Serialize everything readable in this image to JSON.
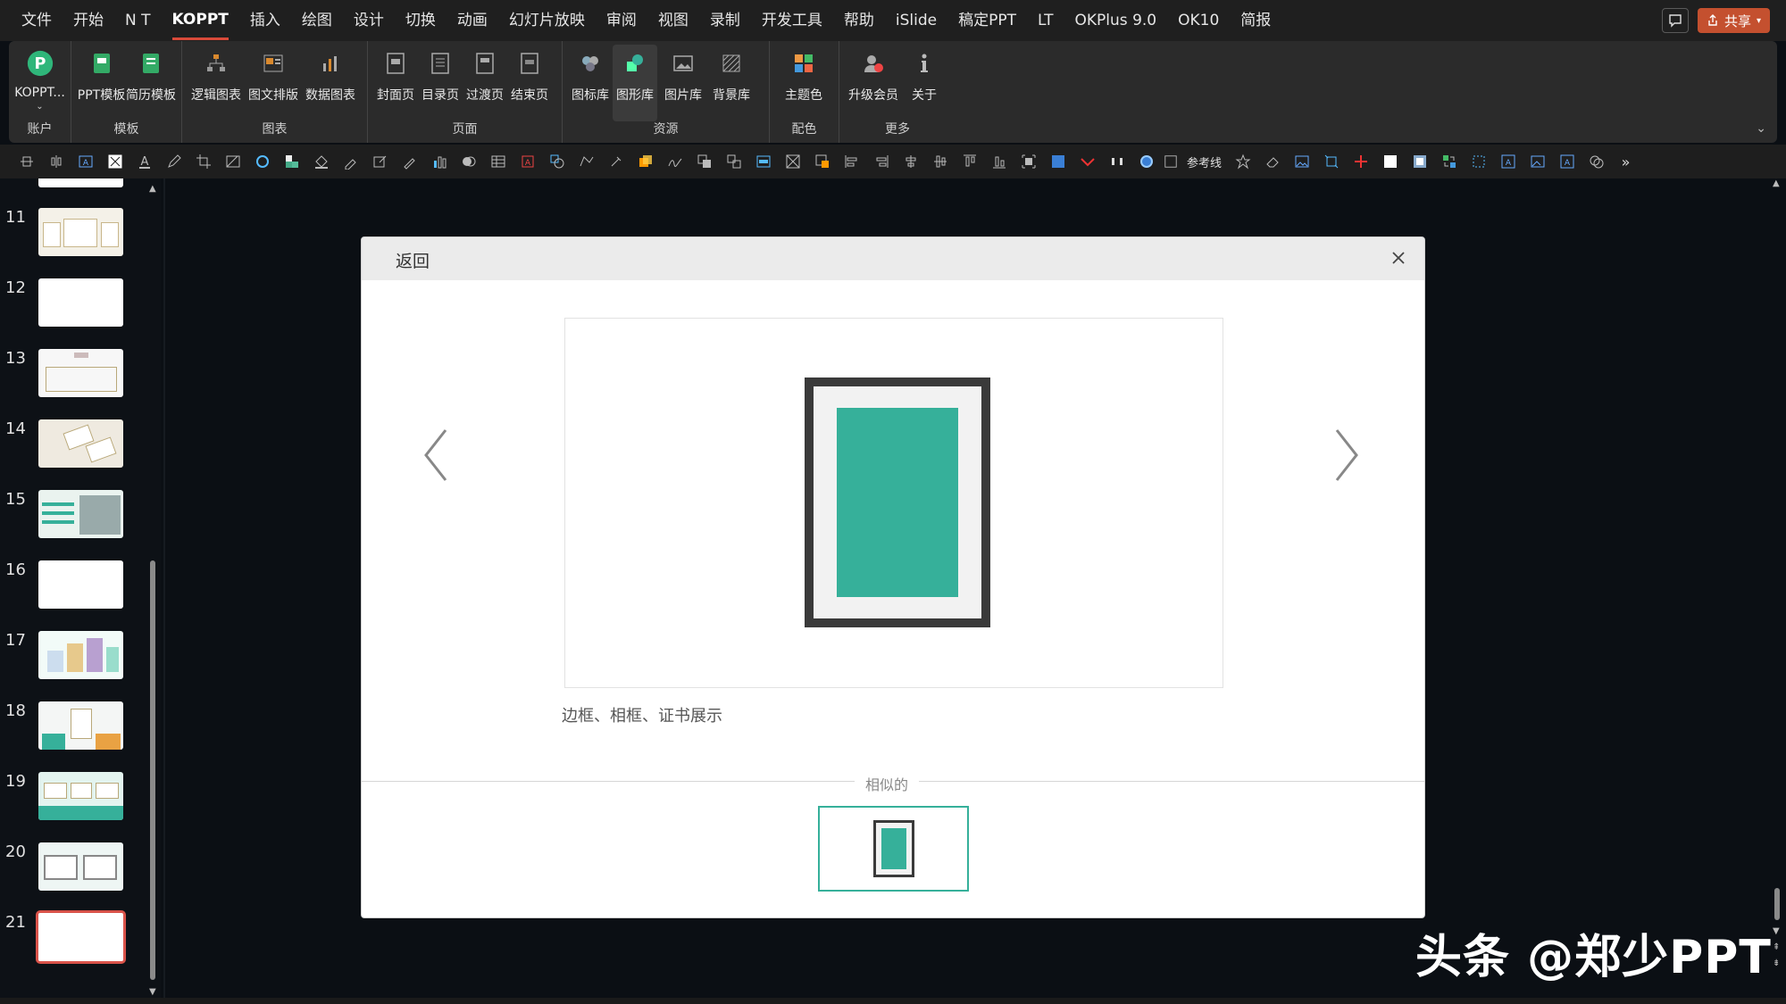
{
  "menubar": {
    "items": [
      "文件",
      "开始",
      "N T",
      "KOPPT",
      "插入",
      "绘图",
      "设计",
      "切换",
      "动画",
      "幻灯片放映",
      "审阅",
      "视图",
      "录制",
      "开发工具",
      "帮助",
      "iSlide",
      "稿定PPT",
      "LT",
      "OKPlus 9.0",
      "OK10",
      "简报"
    ],
    "active": "KOPPT",
    "share_label": "共享"
  },
  "ribbon": {
    "groups": [
      {
        "label": "账户",
        "buttons": [
          {
            "label": "KOPPT...",
            "icon": "koppt-logo-icon"
          }
        ]
      },
      {
        "label": "模板",
        "buttons": [
          {
            "label": "PPT模板",
            "icon": "ppt-template-icon"
          },
          {
            "label": "简历模板",
            "icon": "resume-template-icon"
          }
        ]
      },
      {
        "label": "图表",
        "buttons": [
          {
            "label": "逻辑图表",
            "icon": "logic-chart-icon"
          },
          {
            "label": "图文排版",
            "icon": "layout-icon"
          },
          {
            "label": "数据图表",
            "icon": "data-chart-icon"
          }
        ]
      },
      {
        "label": "页面",
        "buttons": [
          {
            "label": "封面页",
            "icon": "cover-page-icon"
          },
          {
            "label": "目录页",
            "icon": "toc-page-icon"
          },
          {
            "label": "过渡页",
            "icon": "transition-page-icon"
          },
          {
            "label": "结束页",
            "icon": "end-page-icon"
          }
        ]
      },
      {
        "label": "资源",
        "buttons": [
          {
            "label": "图标库",
            "icon": "icon-library-icon"
          },
          {
            "label": "图形库",
            "icon": "shape-library-icon"
          },
          {
            "label": "图片库",
            "icon": "image-library-icon"
          },
          {
            "label": "背景库",
            "icon": "background-library-icon"
          }
        ]
      },
      {
        "label": "配色",
        "buttons": [
          {
            "label": "主题色",
            "icon": "theme-color-icon"
          }
        ]
      },
      {
        "label": "更多",
        "buttons": [
          {
            "label": "升级会员",
            "icon": "upgrade-member-icon"
          },
          {
            "label": "关于",
            "icon": "about-icon"
          }
        ]
      }
    ]
  },
  "toolbar": {
    "reference_line_label": "参考线"
  },
  "slides": {
    "numbers": [
      "11",
      "12",
      "13",
      "14",
      "15",
      "16",
      "17",
      "18",
      "19",
      "20",
      "21"
    ],
    "selected": "21"
  },
  "dialog": {
    "back_label": "返回",
    "caption": "边框、相框、证书展示",
    "similar_label": "相似的"
  },
  "watermark": "头条 @郑少PPT",
  "colors": {
    "accent_teal": "#36b09a",
    "share_orange": "#c4502f",
    "active_red": "#d94a3a"
  }
}
